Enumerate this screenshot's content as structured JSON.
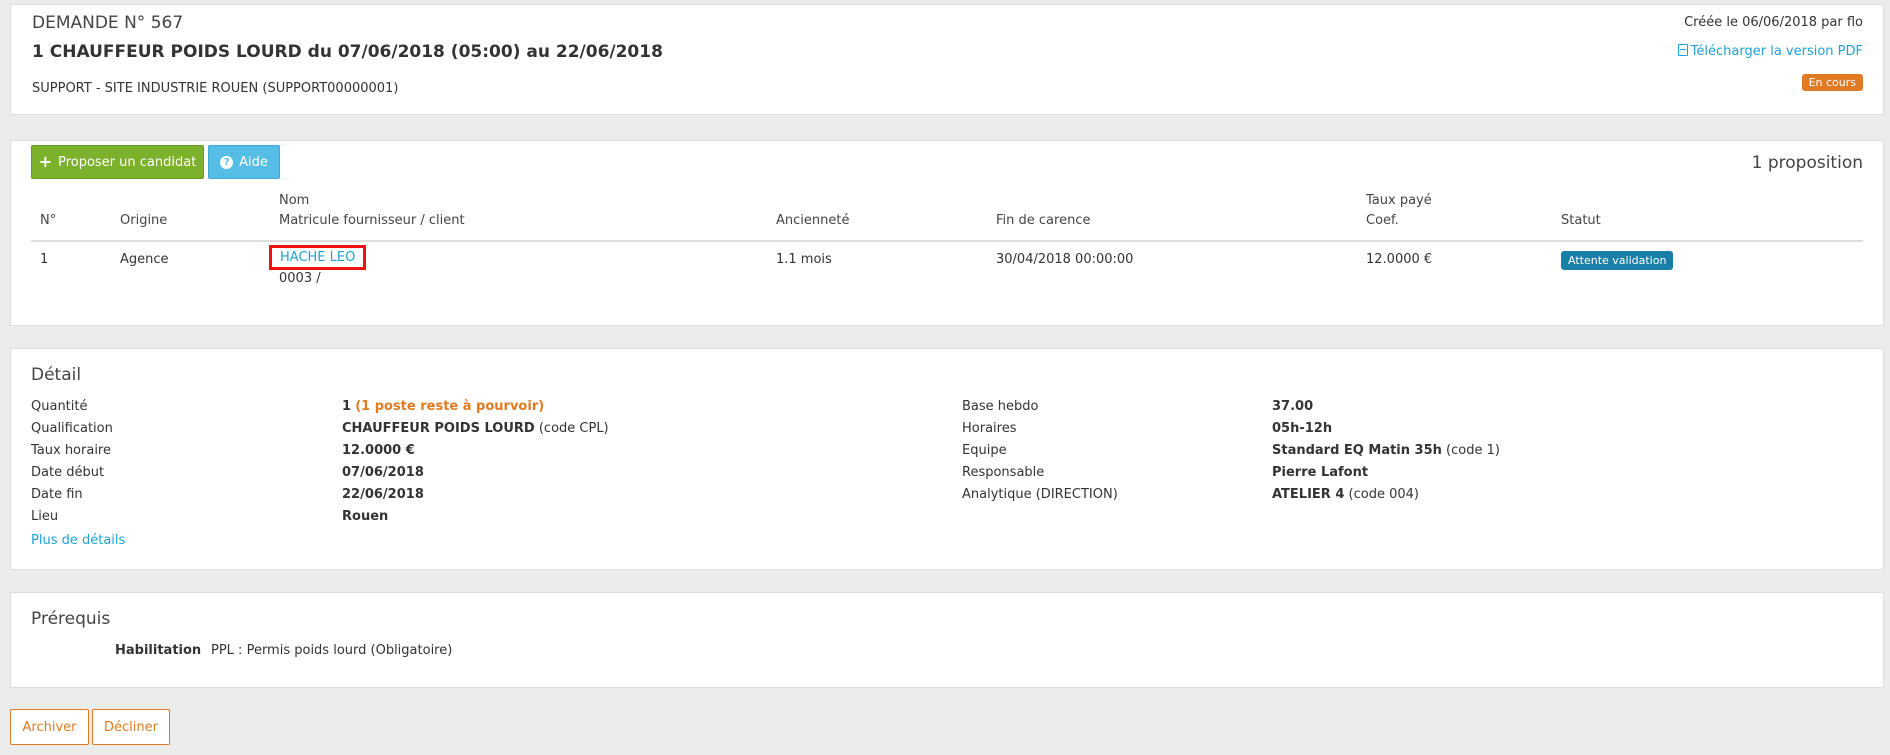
{
  "header": {
    "demand_number": "DEMANDE N° 567",
    "title": "1 CHAUFFEUR POIDS LOURD du 07/06/2018 (05:00) au 22/06/2018",
    "client": "SUPPORT - SITE INDUSTRIE ROUEN (SUPPORT00000001)",
    "created": "Créée le 06/06/2018 par flo",
    "pdf_link": "Télécharger la version PDF",
    "status": "En cours",
    "status_color": "#e07b24"
  },
  "propositions": {
    "propose_button": "Proposer un candidat",
    "help_button": "Aide",
    "count": "1 proposition",
    "columns": {
      "num": "N°",
      "origin": "Origine",
      "name": "Nom",
      "matricule": "Matricule fournisseur / client",
      "seniority": "Ancienneté",
      "end_grace": "Fin de carence",
      "rate": "Taux payé",
      "coef": "Coef.",
      "status": "Statut"
    },
    "rows": [
      {
        "num": "1",
        "origin": "Agence",
        "name": "HACHE LEO",
        "matricule": "0003 /",
        "seniority": "1.1 mois",
        "end_grace": "30/04/2018 00:00:00",
        "rate": "12.0000 €",
        "status": "Attente validation"
      }
    ]
  },
  "detail": {
    "title": "Détail",
    "left": [
      {
        "label": "Quantité",
        "value": "1",
        "extra": "(1 poste reste à pourvoir)"
      },
      {
        "label": "Qualification",
        "value": "CHAUFFEUR POIDS LOURD",
        "extra": "(code CPL)"
      },
      {
        "label": "Taux horaire",
        "value": "12.0000 €",
        "extra": ""
      },
      {
        "label": "Date début",
        "value": "07/06/2018",
        "extra": ""
      },
      {
        "label": "Date fin",
        "value": "22/06/2018",
        "extra": ""
      },
      {
        "label": "Lieu",
        "value": "Rouen",
        "extra": ""
      }
    ],
    "right": [
      {
        "label": "Base hebdo",
        "value": "37.00",
        "extra": ""
      },
      {
        "label": "Horaires",
        "value": "05h-12h",
        "extra": ""
      },
      {
        "label": "Equipe",
        "value": "Standard EQ Matin 35h",
        "extra": "(code 1)"
      },
      {
        "label": "Responsable",
        "value": "Pierre Lafont",
        "extra": ""
      },
      {
        "label": "Analytique (DIRECTION)",
        "value": "ATELIER 4",
        "extra": "(code 004)"
      }
    ],
    "more_link": "Plus de détails"
  },
  "prereq": {
    "title": "Prérequis",
    "label": "Habilitation",
    "value": "PPL : Permis poids lourd (Obligatoire)"
  },
  "actions": {
    "archive": "Archiver",
    "decline": "Décliner"
  }
}
